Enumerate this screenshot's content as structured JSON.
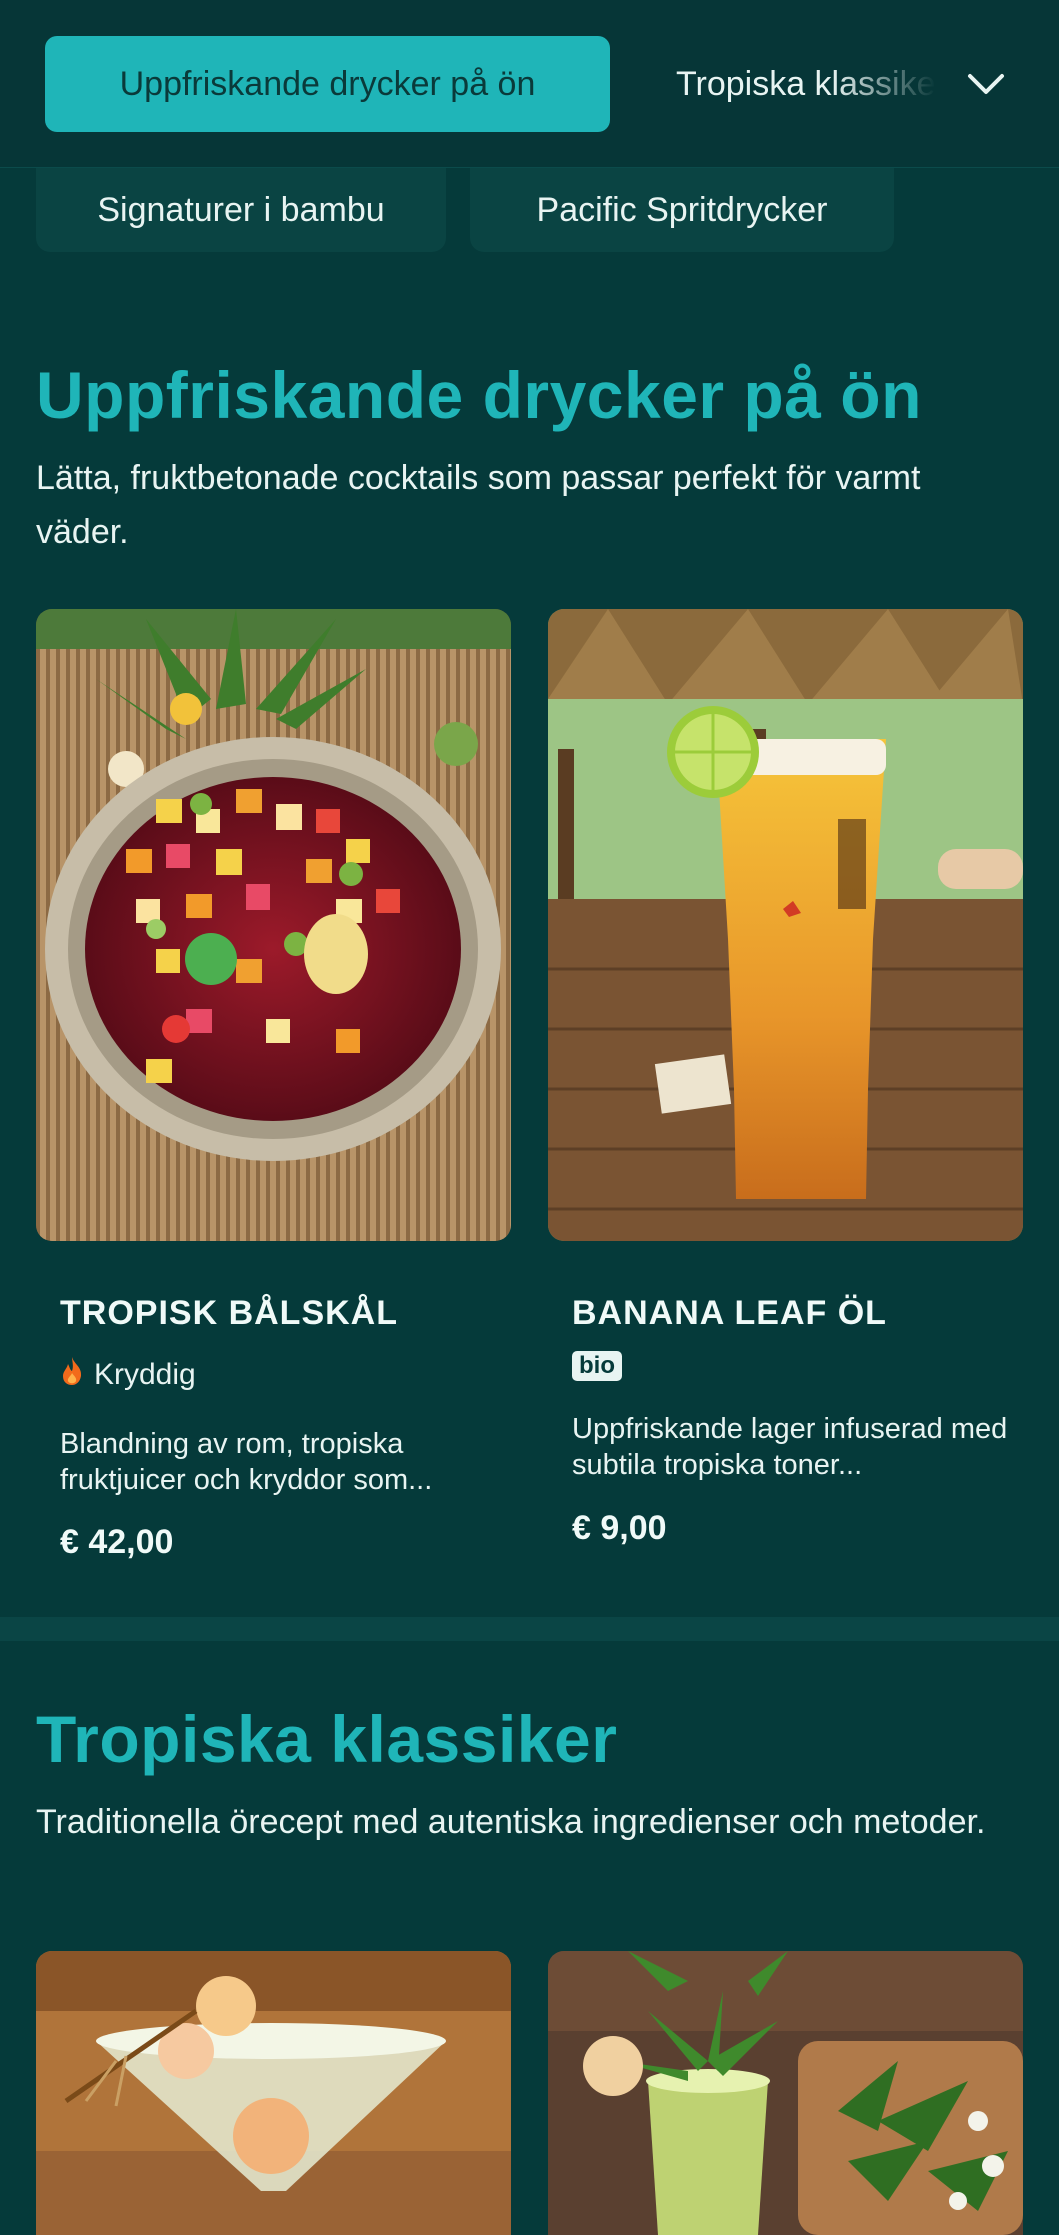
{
  "nav": {
    "active_tab": "Uppfriskande drycker på ön",
    "next_tab": "Tropiska klassiker",
    "chips": [
      "Signaturer i bambu",
      "Pacific Spritdrycker"
    ]
  },
  "sections": [
    {
      "title": "Uppfriskande drycker på ön",
      "description": "Lätta, fruktbetonade cocktails som passar perfekt för varmt väder.",
      "items": [
        {
          "name": "TROPISK BÅLSKÅL",
          "tag": "Kryddig",
          "tag_icon": "fire-icon",
          "description": "Blandning av rom, tropiska fruktjuicer och kryddor som...",
          "price": "€ 42,00"
        },
        {
          "name": "BANANA LEAF ÖL",
          "tag": "bio",
          "description": "Uppfriskande lager infuserad med subtila tropiska toner...",
          "price": "€ 9,00"
        }
      ]
    },
    {
      "title": "Tropiska klassiker",
      "description": "Traditionella örecept med autentiska ingredienser och metoder."
    }
  ],
  "colors": {
    "background": "#053a3a",
    "accent": "#1fb5b8",
    "chip": "#0a4443",
    "spicy": "#f26a1b"
  }
}
